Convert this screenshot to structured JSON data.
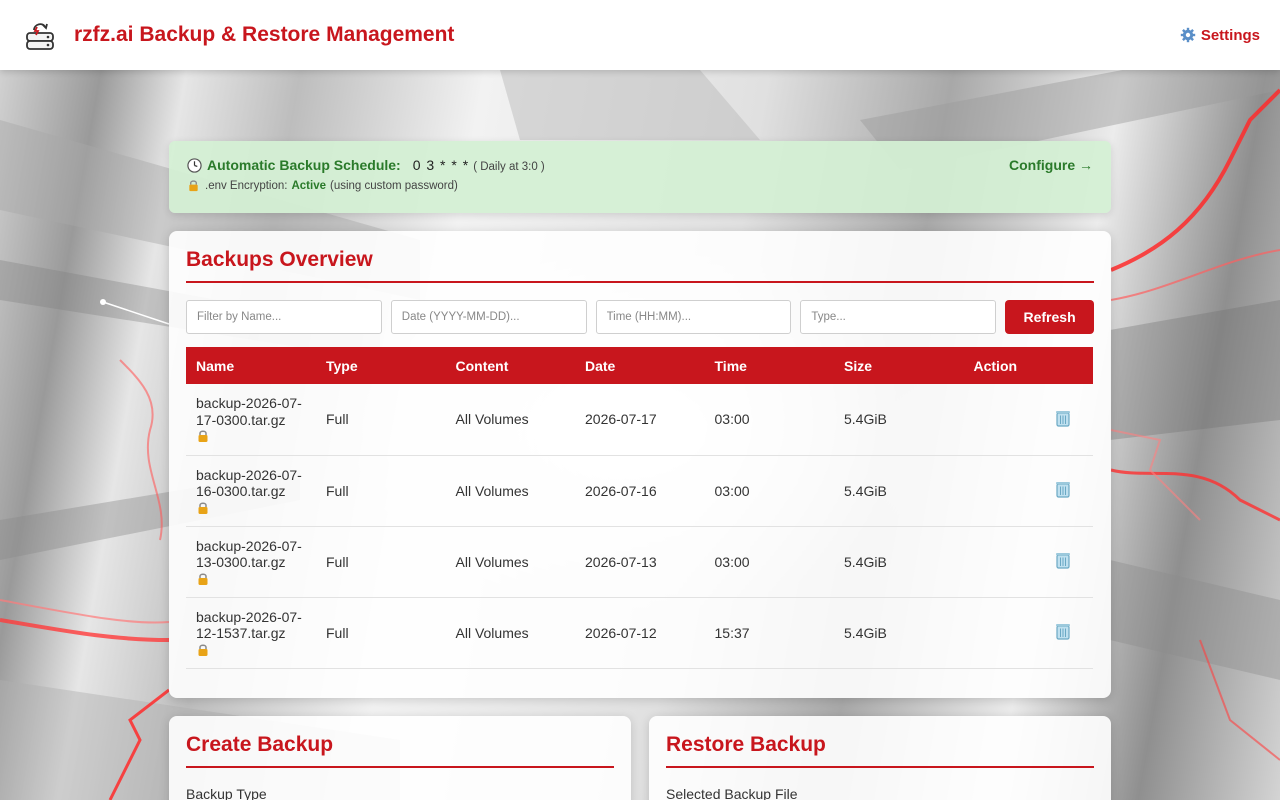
{
  "header": {
    "title": "rzfz.ai Backup & Restore Management",
    "settings_label": "Settings",
    "logo_icon": "backup-drive-icon",
    "settings_icon": "gear-icon"
  },
  "schedule": {
    "label": "Automatic Backup Schedule:",
    "cron": "0 3 * * *",
    "cron_description": "( Daily at 3:0 )",
    "configure_label": "Configure →",
    "encryption_prefix": ".env Encryption:",
    "encryption_status": "Active",
    "encryption_note": "(using custom password)"
  },
  "overview": {
    "title": "Backups Overview",
    "filters": {
      "name_placeholder": "Filter by Name...",
      "date_placeholder": "Date (YYYY-MM-DD)...",
      "time_placeholder": "Time (HH:MM)...",
      "type_placeholder": "Type..."
    },
    "refresh_label": "Refresh",
    "columns": [
      "Name",
      "Type",
      "Content",
      "Date",
      "Time",
      "Size",
      "Action"
    ],
    "rows": [
      {
        "name_line1": "backup-2026-07-",
        "name_line2": "17-0300.tar.gz",
        "type": "Full",
        "content": "All Volumes",
        "date": "2026-07-17",
        "time": "03:00",
        "size": "5.4GiB"
      },
      {
        "name_line1": "backup-2026-07-",
        "name_line2": "16-0300.tar.gz",
        "type": "Full",
        "content": "All Volumes",
        "date": "2026-07-16",
        "time": "03:00",
        "size": "5.4GiB"
      },
      {
        "name_line1": "backup-2026-07-",
        "name_line2": "13-0300.tar.gz",
        "type": "Full",
        "content": "All Volumes",
        "date": "2026-07-13",
        "time": "03:00",
        "size": "5.4GiB"
      },
      {
        "name_line1": "backup-2026-07-",
        "name_line2": "12-1537.tar.gz",
        "type": "Full",
        "content": "All Volumes",
        "date": "2026-07-12",
        "time": "15:37",
        "size": "5.4GiB"
      }
    ]
  },
  "create": {
    "title": "Create Backup",
    "backup_type_label": "Backup Type"
  },
  "restore": {
    "title": "Restore Backup",
    "selected_file_label": "Selected Backup File"
  },
  "colors": {
    "accent": "#c8161d",
    "success": "#2a7a2a",
    "banner_bg": "#d4f0d4"
  }
}
